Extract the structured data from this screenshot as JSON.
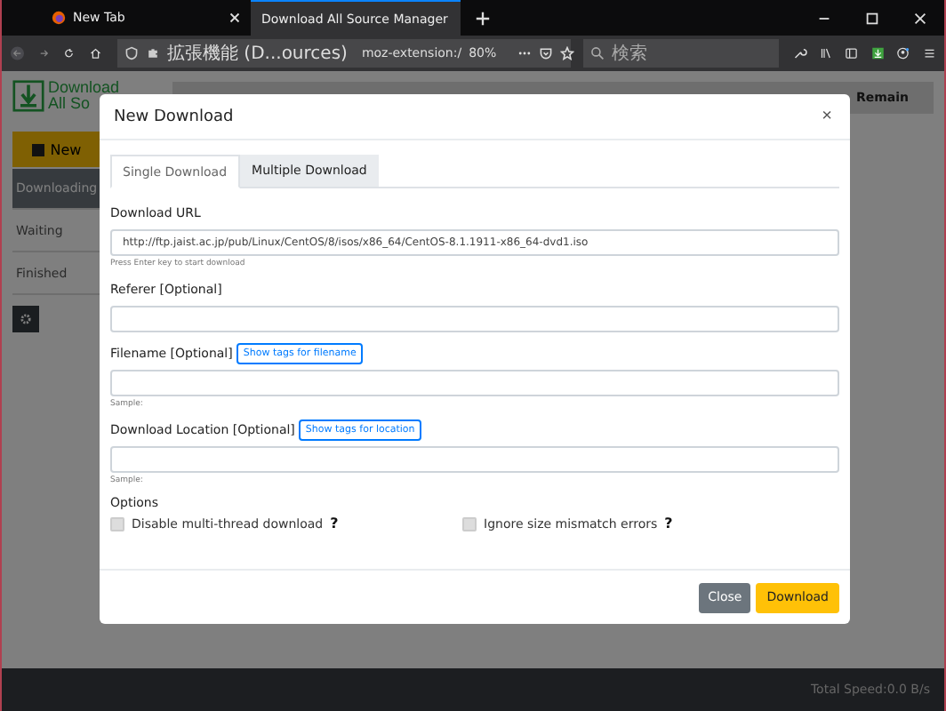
{
  "browser_tabs": [
    {
      "label": "New Tab",
      "selected": false
    },
    {
      "label": "Download All Source Manager",
      "selected": true
    }
  ],
  "toolbar": {
    "site_label": "拡張機能 (D...ources)",
    "url": "moz-extension:/",
    "zoom": "80%",
    "search_placeholder": "検索"
  },
  "page": {
    "logo_lines": [
      "Download",
      "All So"
    ],
    "new_button": "New",
    "sidebar": [
      {
        "label": "Downloading",
        "selected": true
      },
      {
        "label": "Waiting",
        "selected": false
      },
      {
        "label": "Finished",
        "selected": false
      }
    ],
    "header_column": "Remain",
    "status": "Total Speed:0.0 B/s"
  },
  "dialog": {
    "title": "New Download",
    "close_glyph": "×",
    "tabs": [
      {
        "label": "Single Download",
        "selected": true
      },
      {
        "label": "Multiple Download",
        "selected": false
      }
    ],
    "fields": [
      {
        "label": "Download URL",
        "value": "http://ftp.jaist.ac.jp/pub/Linux/CentOS/8/isos/x86_64/CentOS-8.1.1911-x86_64-dvd1.iso",
        "help": "Press Enter key to start download"
      },
      {
        "label": "Referer [Optional]"
      },
      {
        "label": "Filename [Optional]",
        "tag_button": "Show tags for filename",
        "help": "Sample:"
      },
      {
        "label": "Download Location [Optional]",
        "tag_button": "Show tags for location",
        "help": "Sample:"
      }
    ],
    "options_label": "Options",
    "options": [
      {
        "label": "Disable multi-thread download",
        "checked": false,
        "help_glyph": "?"
      },
      {
        "label": "Ignore size mismatch errors",
        "checked": false,
        "help_glyph": "?"
      }
    ],
    "buttons": [
      {
        "label": "Close",
        "kind": "secondary"
      },
      {
        "label": "Download",
        "kind": "primary"
      }
    ]
  }
}
